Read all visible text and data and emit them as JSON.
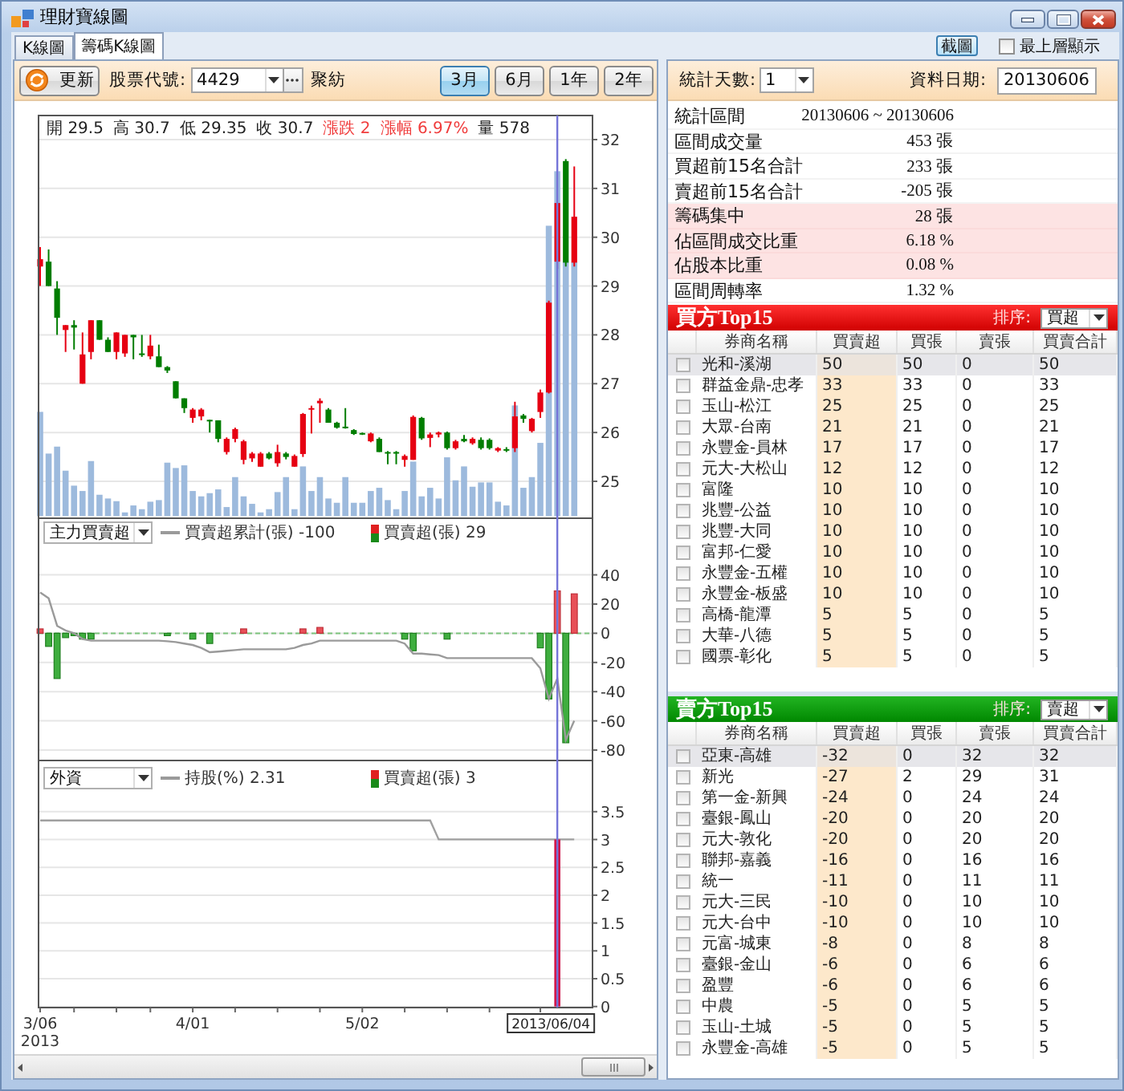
{
  "window": {
    "title": "理財寶線圖"
  },
  "tabs": [
    {
      "label": "K線圖",
      "selected": false
    },
    {
      "label": "籌碼K線圖",
      "selected": true
    }
  ],
  "header_controls": {
    "screenshot_button": "截圖",
    "always_on_top": {
      "label": "最上層顯示",
      "checked": false
    }
  },
  "chart_toolbar": {
    "refresh_button": "更新",
    "symbol_label": "股票代號:",
    "symbol_value": "4429",
    "stock_name": "聚紡",
    "periods": [
      {
        "label": "3月",
        "selected": true
      },
      {
        "label": "6月",
        "selected": false
      },
      {
        "label": "1年",
        "selected": false
      },
      {
        "label": "2年",
        "selected": false
      }
    ]
  },
  "price_panel": {
    "quote": [
      {
        "label": "開",
        "value": "29.5",
        "kind": "price"
      },
      {
        "label": "高",
        "value": "30.7",
        "kind": "price"
      },
      {
        "label": "低",
        "value": "29.35",
        "kind": "price"
      },
      {
        "label": "收",
        "value": "30.7",
        "kind": "price"
      },
      {
        "label": "漲跌",
        "value": "2",
        "kind": "change"
      },
      {
        "label": "漲幅",
        "value": "6.97%",
        "kind": "change"
      },
      {
        "label": "量",
        "value": "578",
        "kind": "price"
      }
    ],
    "y_axis_labels": [
      "32",
      "31",
      "30",
      "29",
      "28",
      "27",
      "26",
      "25"
    ]
  },
  "net_buy_panel": {
    "indicator": "主力買賣超",
    "legend": [
      {
        "kind": "line",
        "label": "買賣超累計(張)",
        "value": "-100"
      },
      {
        "kind": "bar",
        "label": "買賣超(張)",
        "value": "29"
      }
    ],
    "y_axis_labels": [
      "40",
      "20",
      "0",
      "-20",
      "-40",
      "-60",
      "-80"
    ]
  },
  "holding_panel": {
    "indicator": "外資",
    "legend": [
      {
        "kind": "line",
        "label": "持股(%)",
        "value": "2.31"
      },
      {
        "kind": "bar",
        "label": "買賣超(張)",
        "value": "3"
      }
    ],
    "y_axis_labels": [
      "3.5",
      "3",
      "2.5",
      "2",
      "1.5",
      "1",
      "0.5",
      "0"
    ]
  },
  "x_axis": {
    "labels": [
      {
        "date": "3/06",
        "year": "2013"
      },
      {
        "date": "4/01"
      },
      {
        "date": "5/02"
      }
    ],
    "cursor_date": "2013/06/04"
  },
  "stats_toolbar": {
    "days_label": "統計天數:",
    "days_value": "1",
    "date_label": "資料日期:",
    "date_value": "20130606"
  },
  "stats": [
    {
      "label": "統計區間",
      "value": "20130606 ~ 20130606",
      "highlighted": false
    },
    {
      "label": "區間成交量",
      "value": "453 張",
      "highlighted": false
    },
    {
      "label": "買超前15名合計",
      "value": "233 張",
      "highlighted": false
    },
    {
      "label": "賣超前15名合計",
      "value": "-205 張",
      "highlighted": false
    },
    {
      "label": "籌碼集中",
      "value": "28 張",
      "highlighted": true
    },
    {
      "label": "佔區間成交比重",
      "value": "6.18 %",
      "highlighted": true
    },
    {
      "label": "佔股本比重",
      "value": "0.08 %",
      "highlighted": true
    },
    {
      "label": "區間周轉率",
      "value": "1.32 %",
      "highlighted": false
    }
  ],
  "buy_table": {
    "kind": "buy",
    "title": "買方Top15",
    "sort_label": "排序:",
    "sort_value": "買超",
    "columns": [
      "券商名稱",
      "買賣超",
      "買張",
      "賣張",
      "買賣合計"
    ],
    "rows": [
      {
        "broker": "光和-溪湖",
        "net": "50",
        "buy": "50",
        "sell": "0",
        "total": "50",
        "checked": false,
        "selected": true
      },
      {
        "broker": "群益金鼎-忠孝",
        "net": "33",
        "buy": "33",
        "sell": "0",
        "total": "33",
        "checked": false,
        "selected": false
      },
      {
        "broker": "玉山-松江",
        "net": "25",
        "buy": "25",
        "sell": "0",
        "total": "25",
        "checked": false,
        "selected": false
      },
      {
        "broker": "大眾-台南",
        "net": "21",
        "buy": "21",
        "sell": "0",
        "total": "21",
        "checked": false,
        "selected": false
      },
      {
        "broker": "永豐金-員林",
        "net": "17",
        "buy": "17",
        "sell": "0",
        "total": "17",
        "checked": false,
        "selected": false
      },
      {
        "broker": "元大-大松山",
        "net": "12",
        "buy": "12",
        "sell": "0",
        "total": "12",
        "checked": false,
        "selected": false
      },
      {
        "broker": "富隆",
        "net": "10",
        "buy": "10",
        "sell": "0",
        "total": "10",
        "checked": false,
        "selected": false
      },
      {
        "broker": "兆豐-公益",
        "net": "10",
        "buy": "10",
        "sell": "0",
        "total": "10",
        "checked": false,
        "selected": false
      },
      {
        "broker": "兆豐-大同",
        "net": "10",
        "buy": "10",
        "sell": "0",
        "total": "10",
        "checked": false,
        "selected": false
      },
      {
        "broker": "富邦-仁愛",
        "net": "10",
        "buy": "10",
        "sell": "0",
        "total": "10",
        "checked": false,
        "selected": false
      },
      {
        "broker": "永豐金-五權",
        "net": "10",
        "buy": "10",
        "sell": "0",
        "total": "10",
        "checked": false,
        "selected": false
      },
      {
        "broker": "永豐金-板盛",
        "net": "10",
        "buy": "10",
        "sell": "0",
        "total": "10",
        "checked": false,
        "selected": false
      },
      {
        "broker": "高橋-龍潭",
        "net": "5",
        "buy": "5",
        "sell": "0",
        "total": "5",
        "checked": false,
        "selected": false
      },
      {
        "broker": "大華-八德",
        "net": "5",
        "buy": "5",
        "sell": "0",
        "total": "5",
        "checked": false,
        "selected": false
      },
      {
        "broker": "國票-彰化",
        "net": "5",
        "buy": "5",
        "sell": "0",
        "total": "5",
        "checked": false,
        "selected": false
      }
    ]
  },
  "sell_table": {
    "kind": "sell",
    "title": "賣方Top15",
    "sort_label": "排序:",
    "sort_value": "賣超",
    "columns": [
      "券商名稱",
      "買賣超",
      "買張",
      "賣張",
      "買賣合計"
    ],
    "rows": [
      {
        "broker": "亞東-高雄",
        "net": "-32",
        "buy": "0",
        "sell": "32",
        "total": "32",
        "checked": false,
        "selected": true
      },
      {
        "broker": "新光",
        "net": "-27",
        "buy": "2",
        "sell": "29",
        "total": "31",
        "checked": false,
        "selected": false
      },
      {
        "broker": "第一金-新興",
        "net": "-24",
        "buy": "0",
        "sell": "24",
        "total": "24",
        "checked": false,
        "selected": false
      },
      {
        "broker": "臺銀-鳳山",
        "net": "-20",
        "buy": "0",
        "sell": "20",
        "total": "20",
        "checked": false,
        "selected": false
      },
      {
        "broker": "元大-敦化",
        "net": "-20",
        "buy": "0",
        "sell": "20",
        "total": "20",
        "checked": false,
        "selected": false
      },
      {
        "broker": "聯邦-嘉義",
        "net": "-16",
        "buy": "0",
        "sell": "16",
        "total": "16",
        "checked": false,
        "selected": false
      },
      {
        "broker": "統一",
        "net": "-11",
        "buy": "0",
        "sell": "11",
        "total": "11",
        "checked": false,
        "selected": false
      },
      {
        "broker": "元大-三民",
        "net": "-10",
        "buy": "0",
        "sell": "10",
        "total": "10",
        "checked": false,
        "selected": false
      },
      {
        "broker": "元大-台中",
        "net": "-10",
        "buy": "0",
        "sell": "10",
        "total": "10",
        "checked": false,
        "selected": false
      },
      {
        "broker": "元富-城東",
        "net": "-8",
        "buy": "0",
        "sell": "8",
        "total": "8",
        "checked": false,
        "selected": false
      },
      {
        "broker": "臺銀-金山",
        "net": "-6",
        "buy": "0",
        "sell": "6",
        "total": "6",
        "checked": false,
        "selected": false
      },
      {
        "broker": "盈豐",
        "net": "-6",
        "buy": "0",
        "sell": "6",
        "total": "6",
        "checked": false,
        "selected": false
      },
      {
        "broker": "中農",
        "net": "-5",
        "buy": "0",
        "sell": "5",
        "total": "5",
        "checked": false,
        "selected": false
      },
      {
        "broker": "玉山-土城",
        "net": "-5",
        "buy": "0",
        "sell": "5",
        "total": "5",
        "checked": false,
        "selected": false
      },
      {
        "broker": "永豐金-高雄",
        "net": "-5",
        "buy": "0",
        "sell": "5",
        "total": "5",
        "checked": false,
        "selected": false
      }
    ]
  }
}
